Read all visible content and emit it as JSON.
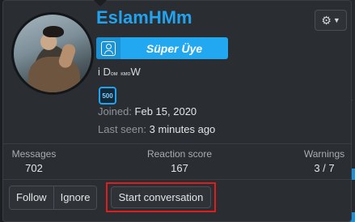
{
  "profile": {
    "username": "EslamHMm",
    "rank": "Süper Üye",
    "custom_title_prefix": "i D",
    "custom_title_small1": "ᴏᴍ",
    "custom_title_mid": " ",
    "custom_title_small2": "ᴋᴍᴏ",
    "custom_title_suffix": "W",
    "badge": "500",
    "joined_label": "Joined:",
    "joined_value": "Feb 15, 2020",
    "lastseen_label": "Last seen:",
    "lastseen_value": "3 minutes ago"
  },
  "stats": {
    "messages_label": "Messages",
    "messages_value": "702",
    "reaction_label": "Reaction score",
    "reaction_value": "167",
    "warnings_label": "Warnings",
    "warnings_value": "3 / 7"
  },
  "actions": {
    "follow": "Follow",
    "ignore": "Ignore",
    "start_conversation": "Start conversation"
  },
  "background": {
    "side_mark": "Ü"
  },
  "icons": {
    "gear": "⚙",
    "caret": "▼"
  },
  "colors": {
    "accent": "#22a3f0",
    "highlight": "#e21b1b"
  }
}
